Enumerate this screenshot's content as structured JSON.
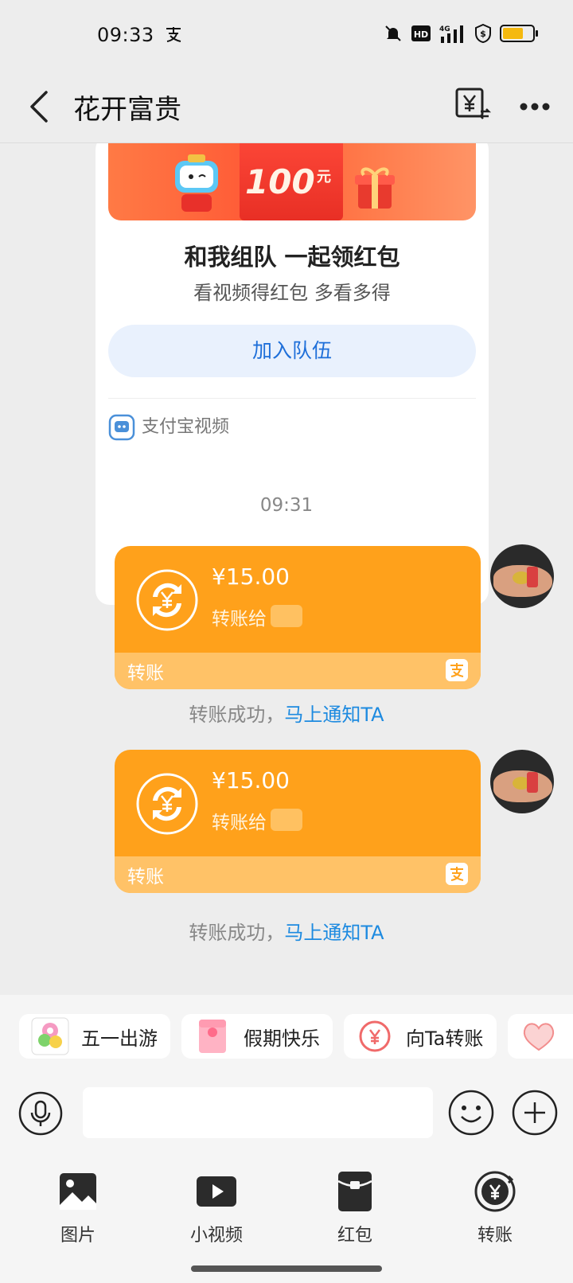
{
  "status_bar": {
    "time": "09:33",
    "network": "4G"
  },
  "header": {
    "title": "花开富贵"
  },
  "card": {
    "banner_amount": "100",
    "banner_unit": "元",
    "title": "和我组队 一起领红包",
    "subtitle": "看视频得红包 多看多得",
    "join_button": "加入队伍",
    "source": "支付宝视频"
  },
  "time_separator": "09:31",
  "transfers": [
    {
      "amount": "¥15.00",
      "to_label": "转账给",
      "footer": "转账",
      "notice": "转账成功，",
      "notice_link": "马上通知TA"
    },
    {
      "amount": "¥15.00",
      "to_label": "转账给",
      "footer": "转账",
      "notice": "转账成功，",
      "notice_link": "马上通知TA"
    }
  ],
  "chips": [
    {
      "label": "五一出游",
      "icon": "flower-card-icon"
    },
    {
      "label": "假期快乐",
      "icon": "red-packet-card-icon"
    },
    {
      "label": "向Ta转账",
      "icon": "yuan-transfer-icon"
    },
    {
      "label": "",
      "icon": "heart-icon"
    }
  ],
  "input": {
    "value": "",
    "placeholder": ""
  },
  "tools": [
    {
      "label": "图片",
      "icon": "image-icon"
    },
    {
      "label": "小视频",
      "icon": "video-icon"
    },
    {
      "label": "红包",
      "icon": "red-packet-icon"
    },
    {
      "label": "转账",
      "icon": "transfer-icon"
    }
  ],
  "colors": {
    "transfer_orange": "#ffa11b",
    "link_blue": "#1d8ae0",
    "background": "#ededed"
  }
}
